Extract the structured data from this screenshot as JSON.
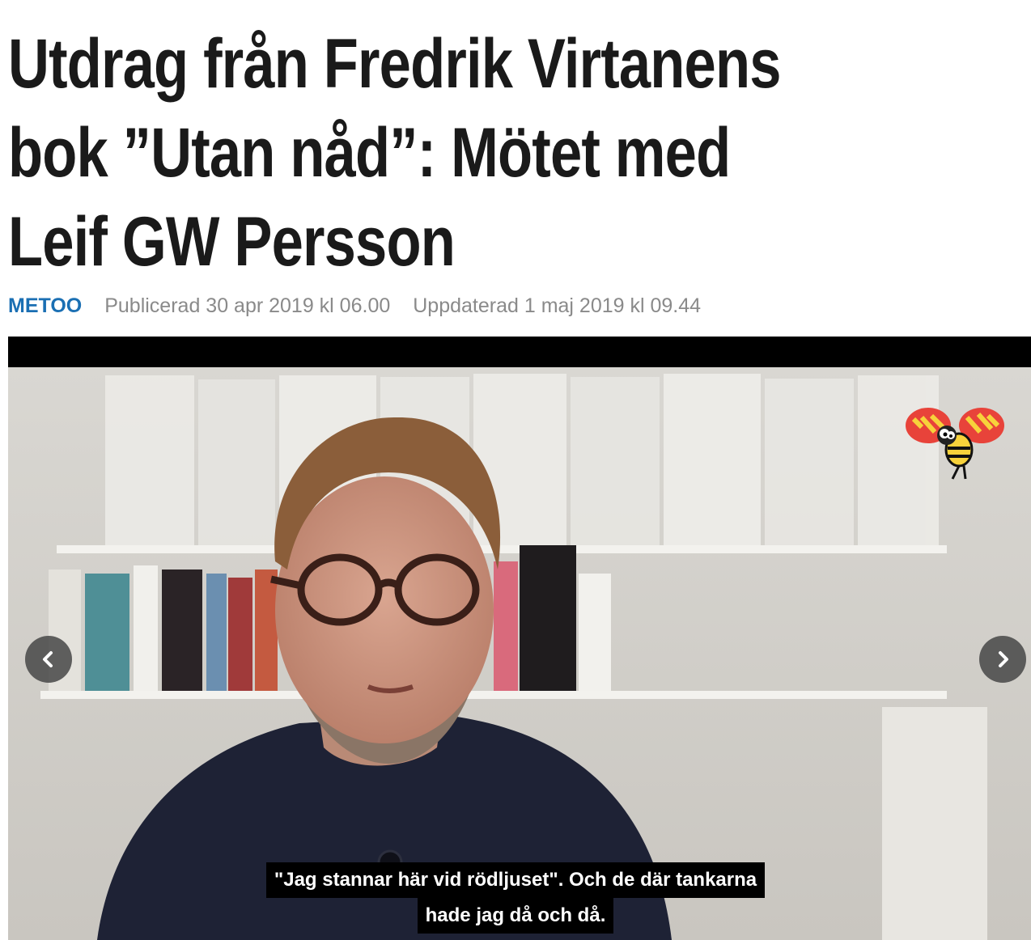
{
  "article": {
    "headline_lines": [
      "Utdrag från Fredrik Virtanens",
      "bok ”Utan nåd”: Mötet med",
      "Leif GW Persson"
    ],
    "tag": "METOO",
    "published": "Publicerad 30 apr 2019 kl 06.00",
    "updated": "Uppdaterad 1 maj 2019 kl 09.44"
  },
  "video": {
    "subtitle_lines": [
      "\"Jag stannar här vid rödljuset\". Och de där tankarna",
      "hade jag då och då."
    ],
    "logo_icon": "wasp-logo-icon",
    "prev_icon": "chevron-left-icon",
    "next_icon": "chevron-right-icon"
  },
  "colors": {
    "tag": "#1a6fb3",
    "meta_text": "#8a8a8a",
    "headline": "#1a1a1a"
  }
}
